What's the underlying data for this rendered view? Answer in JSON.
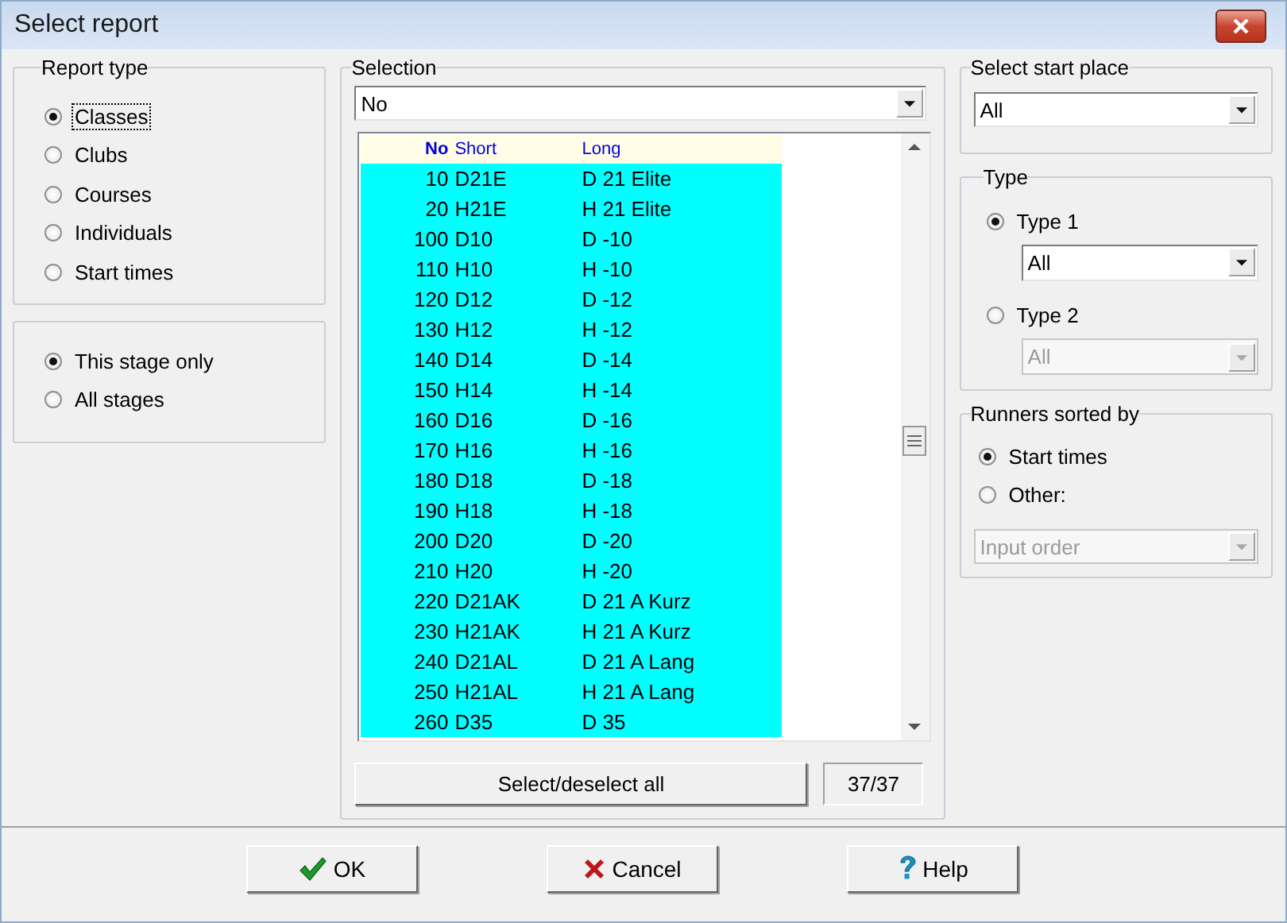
{
  "window": {
    "title": "Select report"
  },
  "report_type": {
    "label": "Report type",
    "options": [
      {
        "label": "Classes",
        "selected": true,
        "focused": true
      },
      {
        "label": "Clubs",
        "selected": false,
        "focused": false
      },
      {
        "label": "Courses",
        "selected": false,
        "focused": false
      },
      {
        "label": "Individuals",
        "selected": false,
        "focused": false
      },
      {
        "label": "Start times",
        "selected": false,
        "focused": false
      }
    ]
  },
  "stage": {
    "options": [
      {
        "label": "This stage only",
        "selected": true
      },
      {
        "label": "All stages",
        "selected": false
      }
    ]
  },
  "selection": {
    "label": "Selection",
    "dropdown": {
      "value": "No"
    },
    "columns": [
      "No",
      "Short",
      "Long"
    ],
    "rows": [
      {
        "no": "10",
        "short": "D21E",
        "long": "D 21 Elite",
        "selected": true
      },
      {
        "no": "20",
        "short": "H21E",
        "long": "H 21 Elite",
        "selected": true
      },
      {
        "no": "100",
        "short": "D10",
        "long": "D -10",
        "selected": true
      },
      {
        "no": "110",
        "short": "H10",
        "long": "H -10",
        "selected": true
      },
      {
        "no": "120",
        "short": "D12",
        "long": "D -12",
        "selected": true
      },
      {
        "no": "130",
        "short": "H12",
        "long": "H -12",
        "selected": true
      },
      {
        "no": "140",
        "short": "D14",
        "long": "D -14",
        "selected": true
      },
      {
        "no": "150",
        "short": "H14",
        "long": "H -14",
        "selected": true
      },
      {
        "no": "160",
        "short": "D16",
        "long": "D -16",
        "selected": true
      },
      {
        "no": "170",
        "short": "H16",
        "long": "H -16",
        "selected": true
      },
      {
        "no": "180",
        "short": "D18",
        "long": "D -18",
        "selected": true
      },
      {
        "no": "190",
        "short": "H18",
        "long": "H -18",
        "selected": true
      },
      {
        "no": "200",
        "short": "D20",
        "long": "D -20",
        "selected": true
      },
      {
        "no": "210",
        "short": "H20",
        "long": "H -20",
        "selected": true
      },
      {
        "no": "220",
        "short": "D21AK",
        "long": "D 21 A Kurz",
        "selected": true
      },
      {
        "no": "230",
        "short": "H21AK",
        "long": "H 21 A Kurz",
        "selected": true
      },
      {
        "no": "240",
        "short": "D21AL",
        "long": "D 21 A Lang",
        "selected": true
      },
      {
        "no": "250",
        "short": "H21AL",
        "long": "H 21 A Lang",
        "selected": true
      },
      {
        "no": "260",
        "short": "D35",
        "long": "D 35",
        "selected": true
      }
    ],
    "select_all_button": "Select/deselect all",
    "count": "37/37"
  },
  "start_place": {
    "label": "Select start place",
    "dropdown": {
      "value": "All",
      "disabled": false
    }
  },
  "type": {
    "label": "Type",
    "options": [
      {
        "label": "Type 1",
        "selected": true,
        "dropdown": {
          "value": "All",
          "disabled": false
        }
      },
      {
        "label": "Type 2",
        "selected": false,
        "dropdown": {
          "value": "All",
          "disabled": true
        }
      }
    ]
  },
  "sorted_by": {
    "label": "Runners sorted by",
    "options": [
      {
        "label": "Start times",
        "selected": true
      },
      {
        "label": "Other:",
        "selected": false
      }
    ],
    "dropdown": {
      "value": "Input order",
      "disabled": true
    }
  },
  "buttons": [
    {
      "label": "OK",
      "kind": "ok"
    },
    {
      "label": "Cancel",
      "kind": "cancel"
    },
    {
      "label": "Help",
      "kind": "help"
    }
  ]
}
